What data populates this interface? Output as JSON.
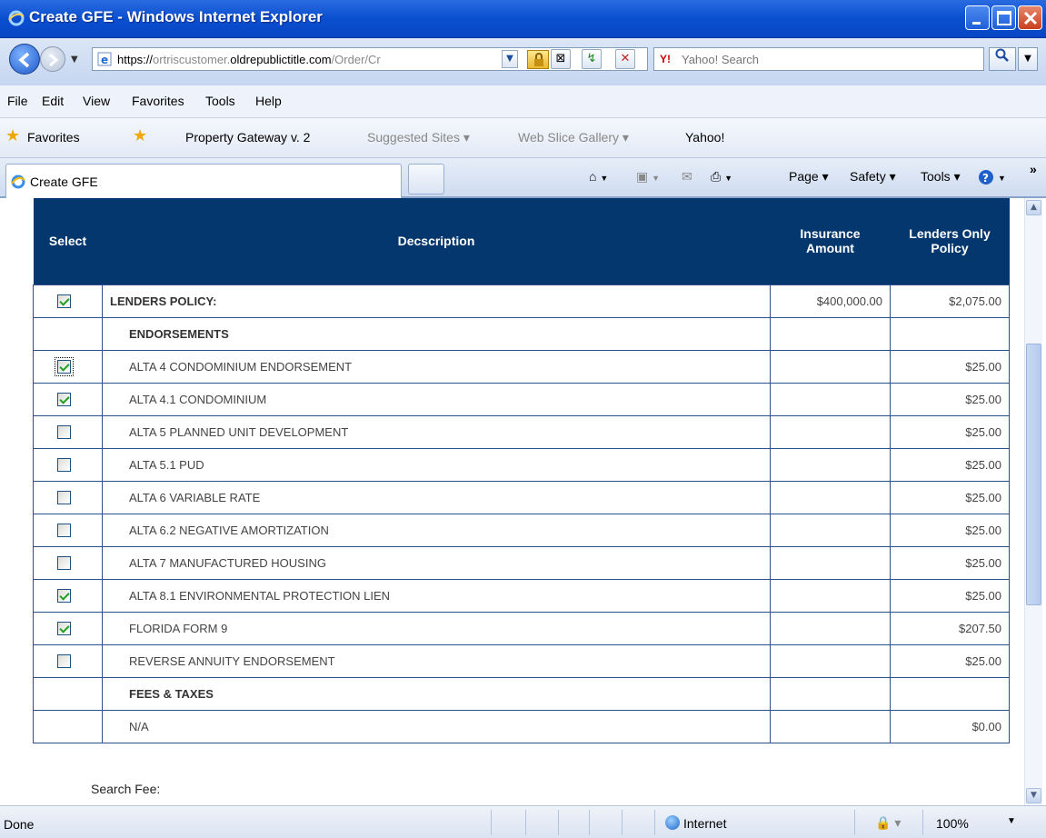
{
  "window": {
    "title": "Create GFE - Windows Internet Explorer"
  },
  "address": {
    "url_scheme": "https://",
    "url_sub": "ortriscustomer.",
    "url_host": "oldrepublictitle.com",
    "url_path": "/Order/Cr",
    "search_placeholder": "Yahoo! Search"
  },
  "menu": [
    "File",
    "Edit",
    "View",
    "Favorites",
    "Tools",
    "Help"
  ],
  "favorites": {
    "label": "Favorites",
    "items": [
      "Property Gateway v. 2",
      "Suggested Sites ▾",
      "Web Slice Gallery ▾",
      "Yahoo!"
    ]
  },
  "tab": {
    "label": "Create GFE"
  },
  "commands": {
    "page": "Page ▾",
    "safety": "Safety ▾",
    "tools": "Tools ▾",
    "overflow": "»"
  },
  "table": {
    "headers": {
      "select": "Select",
      "description": "Decscription",
      "insurance": "Insurance Amount",
      "lenders": "Lenders Only Policy"
    },
    "rows": [
      {
        "checkbox": true,
        "checked": true,
        "focus": false,
        "desc": "LENDERS POLICY:",
        "bold": true,
        "indent": false,
        "insurance": "$400,000.00",
        "lenders": "$2,075.00"
      },
      {
        "checkbox": false,
        "checked": false,
        "focus": false,
        "desc": "ENDORSEMENTS",
        "bold": true,
        "indent": true,
        "insurance": "",
        "lenders": ""
      },
      {
        "checkbox": true,
        "checked": true,
        "focus": true,
        "desc": "ALTA 4 CONDOMINIUM ENDORSEMENT",
        "bold": false,
        "indent": true,
        "insurance": "",
        "lenders": "$25.00"
      },
      {
        "checkbox": true,
        "checked": true,
        "focus": false,
        "desc": "ALTA 4.1 CONDOMINIUM",
        "bold": false,
        "indent": true,
        "insurance": "",
        "lenders": "$25.00"
      },
      {
        "checkbox": true,
        "checked": false,
        "focus": false,
        "desc": "ALTA 5 PLANNED UNIT DEVELOPMENT",
        "bold": false,
        "indent": true,
        "insurance": "",
        "lenders": "$25.00"
      },
      {
        "checkbox": true,
        "checked": false,
        "focus": false,
        "desc": "ALTA 5.1 PUD",
        "bold": false,
        "indent": true,
        "insurance": "",
        "lenders": "$25.00"
      },
      {
        "checkbox": true,
        "checked": false,
        "focus": false,
        "desc": "ALTA 6 VARIABLE RATE",
        "bold": false,
        "indent": true,
        "insurance": "",
        "lenders": "$25.00"
      },
      {
        "checkbox": true,
        "checked": false,
        "focus": false,
        "desc": "ALTA 6.2 NEGATIVE AMORTIZATION",
        "bold": false,
        "indent": true,
        "insurance": "",
        "lenders": "$25.00"
      },
      {
        "checkbox": true,
        "checked": false,
        "focus": false,
        "desc": "ALTA 7 MANUFACTURED HOUSING",
        "bold": false,
        "indent": true,
        "insurance": "",
        "lenders": "$25.00"
      },
      {
        "checkbox": true,
        "checked": true,
        "focus": false,
        "desc": "ALTA 8.1 ENVIRONMENTAL PROTECTION LIEN",
        "bold": false,
        "indent": true,
        "insurance": "",
        "lenders": "$25.00"
      },
      {
        "checkbox": true,
        "checked": true,
        "focus": false,
        "desc": "FLORIDA FORM 9",
        "bold": false,
        "indent": true,
        "insurance": "",
        "lenders": "$207.50"
      },
      {
        "checkbox": true,
        "checked": false,
        "focus": false,
        "desc": "REVERSE ANNUITY ENDORSEMENT",
        "bold": false,
        "indent": true,
        "insurance": "",
        "lenders": "$25.00"
      },
      {
        "checkbox": false,
        "checked": false,
        "focus": false,
        "desc": "FEES & TAXES",
        "bold": true,
        "indent": true,
        "insurance": "",
        "lenders": ""
      },
      {
        "checkbox": false,
        "checked": false,
        "focus": false,
        "desc": "N/A",
        "bold": false,
        "indent": true,
        "insurance": "",
        "lenders": "$0.00"
      }
    ]
  },
  "search_fee_label": "Search Fee:",
  "status": {
    "text": "Done",
    "zone": "Internet",
    "zoom": "100%"
  }
}
